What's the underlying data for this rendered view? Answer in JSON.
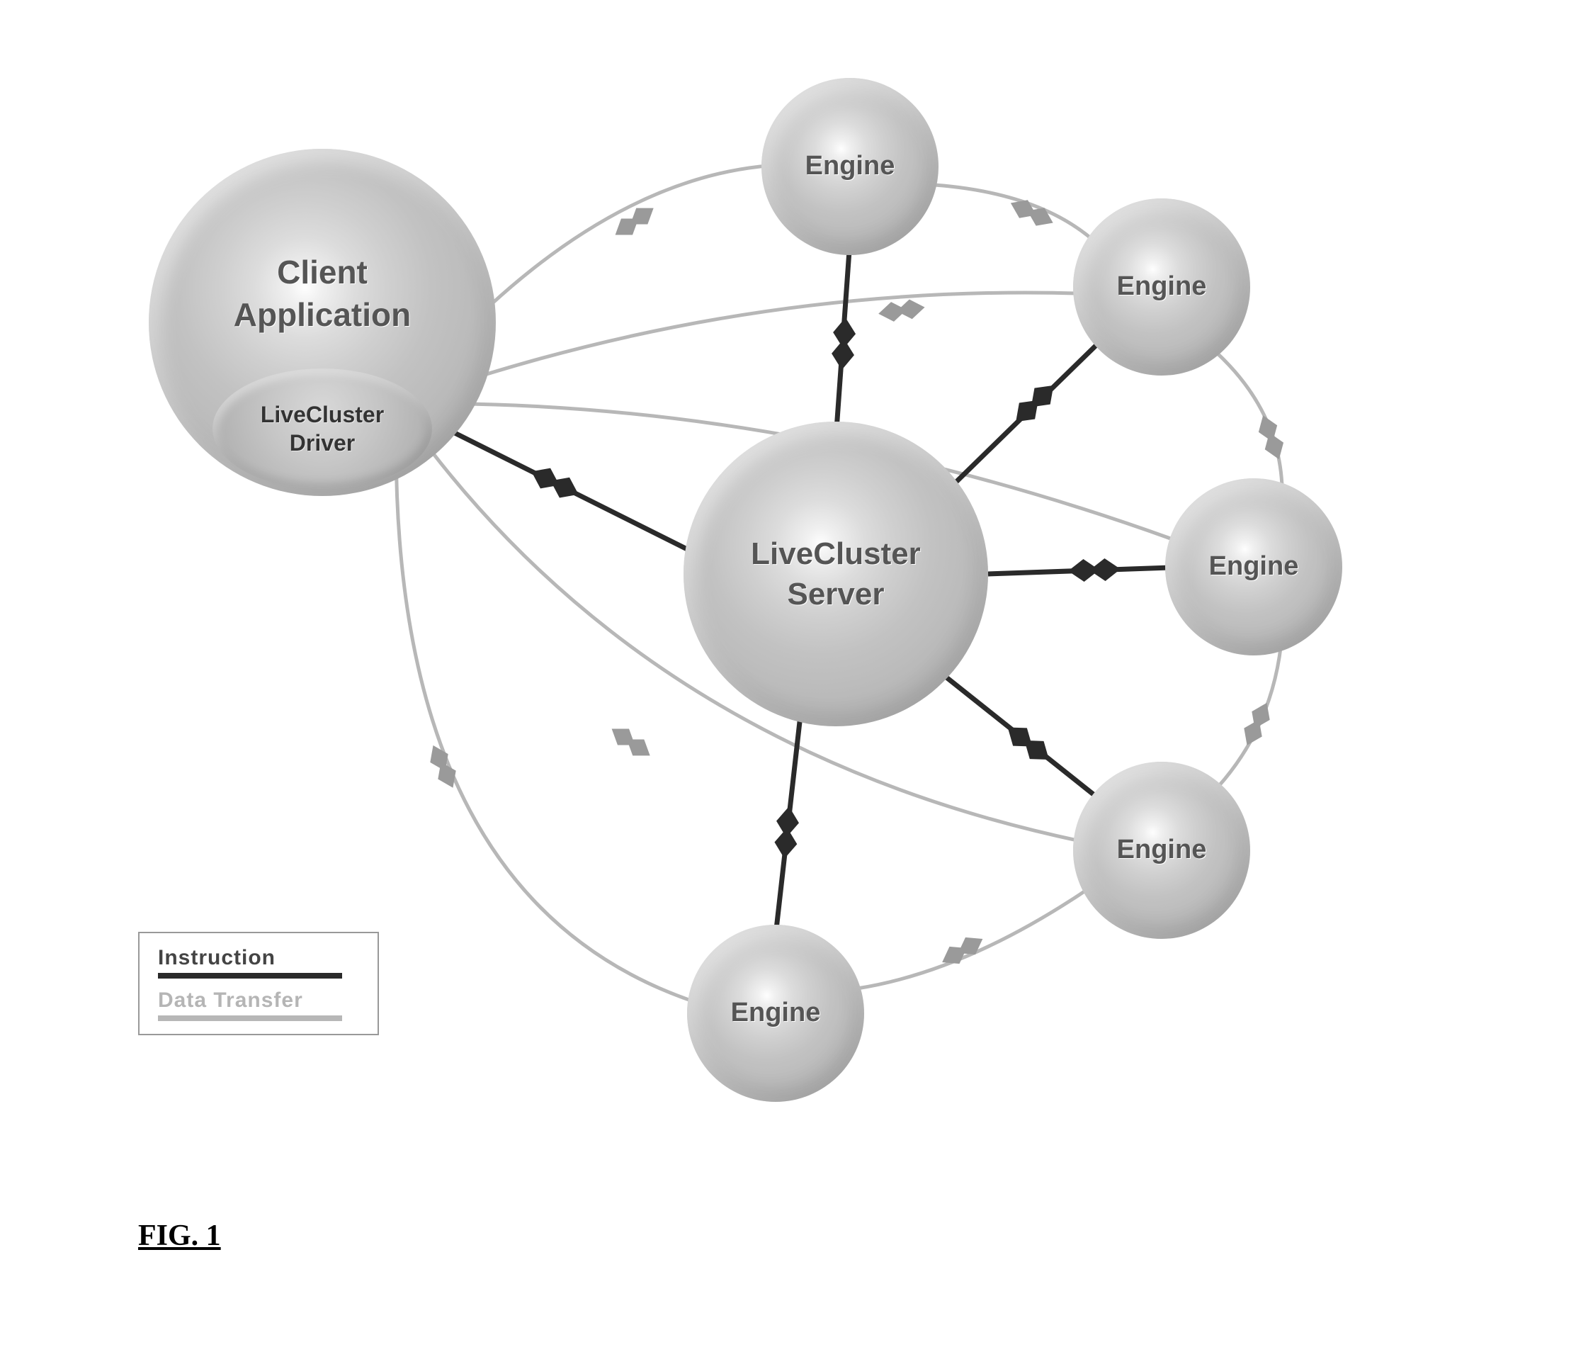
{
  "nodes": {
    "client": {
      "title_line1": "Client",
      "title_line2": "Application",
      "driver_line1": "LiveCluster",
      "driver_line2": "Driver"
    },
    "server": {
      "title_line1": "LiveCluster",
      "title_line2": "Server"
    },
    "engine1": {
      "label": "Engine"
    },
    "engine2": {
      "label": "Engine"
    },
    "engine3": {
      "label": "Engine"
    },
    "engine4": {
      "label": "Engine"
    },
    "engine5": {
      "label": "Engine"
    }
  },
  "legend": {
    "instruction_label": "Instruction",
    "data_label": "Data Transfer"
  },
  "figure_caption": "FIG. 1",
  "colors": {
    "instruction_line": "#2a2a2a",
    "data_line": "#b7b7b7",
    "arrow_dark": "#2a2a2a",
    "arrow_gray": "#9a9a9a"
  },
  "connections": {
    "instruction": [
      {
        "from": "client",
        "to": "server"
      },
      {
        "from": "server",
        "to": "engine1"
      },
      {
        "from": "server",
        "to": "engine2"
      },
      {
        "from": "server",
        "to": "engine3"
      },
      {
        "from": "server",
        "to": "engine4"
      },
      {
        "from": "server",
        "to": "engine5"
      }
    ],
    "data": [
      {
        "from": "client",
        "to": "engine1"
      },
      {
        "from": "client",
        "to": "engine2"
      },
      {
        "from": "client",
        "to": "engine3"
      },
      {
        "from": "client",
        "to": "engine4"
      },
      {
        "from": "client",
        "to": "engine5"
      },
      {
        "from": "engine1",
        "to": "engine2"
      },
      {
        "from": "engine2",
        "to": "engine3"
      },
      {
        "from": "engine3",
        "to": "engine4"
      },
      {
        "from": "engine4",
        "to": "engine5"
      }
    ]
  }
}
